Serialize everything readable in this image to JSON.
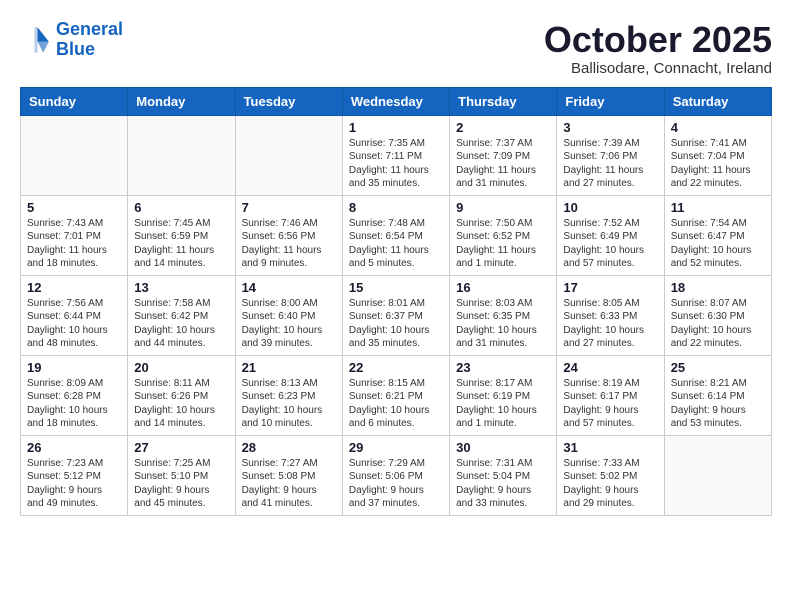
{
  "logo": {
    "line1": "General",
    "line2": "Blue"
  },
  "title": "October 2025",
  "subtitle": "Ballisodare, Connacht, Ireland",
  "days_header": [
    "Sunday",
    "Monday",
    "Tuesday",
    "Wednesday",
    "Thursday",
    "Friday",
    "Saturday"
  ],
  "weeks": [
    [
      {
        "day": "",
        "info": ""
      },
      {
        "day": "",
        "info": ""
      },
      {
        "day": "",
        "info": ""
      },
      {
        "day": "1",
        "info": "Sunrise: 7:35 AM\nSunset: 7:11 PM\nDaylight: 11 hours\nand 35 minutes."
      },
      {
        "day": "2",
        "info": "Sunrise: 7:37 AM\nSunset: 7:09 PM\nDaylight: 11 hours\nand 31 minutes."
      },
      {
        "day": "3",
        "info": "Sunrise: 7:39 AM\nSunset: 7:06 PM\nDaylight: 11 hours\nand 27 minutes."
      },
      {
        "day": "4",
        "info": "Sunrise: 7:41 AM\nSunset: 7:04 PM\nDaylight: 11 hours\nand 22 minutes."
      }
    ],
    [
      {
        "day": "5",
        "info": "Sunrise: 7:43 AM\nSunset: 7:01 PM\nDaylight: 11 hours\nand 18 minutes."
      },
      {
        "day": "6",
        "info": "Sunrise: 7:45 AM\nSunset: 6:59 PM\nDaylight: 11 hours\nand 14 minutes."
      },
      {
        "day": "7",
        "info": "Sunrise: 7:46 AM\nSunset: 6:56 PM\nDaylight: 11 hours\nand 9 minutes."
      },
      {
        "day": "8",
        "info": "Sunrise: 7:48 AM\nSunset: 6:54 PM\nDaylight: 11 hours\nand 5 minutes."
      },
      {
        "day": "9",
        "info": "Sunrise: 7:50 AM\nSunset: 6:52 PM\nDaylight: 11 hours\nand 1 minute."
      },
      {
        "day": "10",
        "info": "Sunrise: 7:52 AM\nSunset: 6:49 PM\nDaylight: 10 hours\nand 57 minutes."
      },
      {
        "day": "11",
        "info": "Sunrise: 7:54 AM\nSunset: 6:47 PM\nDaylight: 10 hours\nand 52 minutes."
      }
    ],
    [
      {
        "day": "12",
        "info": "Sunrise: 7:56 AM\nSunset: 6:44 PM\nDaylight: 10 hours\nand 48 minutes."
      },
      {
        "day": "13",
        "info": "Sunrise: 7:58 AM\nSunset: 6:42 PM\nDaylight: 10 hours\nand 44 minutes."
      },
      {
        "day": "14",
        "info": "Sunrise: 8:00 AM\nSunset: 6:40 PM\nDaylight: 10 hours\nand 39 minutes."
      },
      {
        "day": "15",
        "info": "Sunrise: 8:01 AM\nSunset: 6:37 PM\nDaylight: 10 hours\nand 35 minutes."
      },
      {
        "day": "16",
        "info": "Sunrise: 8:03 AM\nSunset: 6:35 PM\nDaylight: 10 hours\nand 31 minutes."
      },
      {
        "day": "17",
        "info": "Sunrise: 8:05 AM\nSunset: 6:33 PM\nDaylight: 10 hours\nand 27 minutes."
      },
      {
        "day": "18",
        "info": "Sunrise: 8:07 AM\nSunset: 6:30 PM\nDaylight: 10 hours\nand 22 minutes."
      }
    ],
    [
      {
        "day": "19",
        "info": "Sunrise: 8:09 AM\nSunset: 6:28 PM\nDaylight: 10 hours\nand 18 minutes."
      },
      {
        "day": "20",
        "info": "Sunrise: 8:11 AM\nSunset: 6:26 PM\nDaylight: 10 hours\nand 14 minutes."
      },
      {
        "day": "21",
        "info": "Sunrise: 8:13 AM\nSunset: 6:23 PM\nDaylight: 10 hours\nand 10 minutes."
      },
      {
        "day": "22",
        "info": "Sunrise: 8:15 AM\nSunset: 6:21 PM\nDaylight: 10 hours\nand 6 minutes."
      },
      {
        "day": "23",
        "info": "Sunrise: 8:17 AM\nSunset: 6:19 PM\nDaylight: 10 hours\nand 1 minute."
      },
      {
        "day": "24",
        "info": "Sunrise: 8:19 AM\nSunset: 6:17 PM\nDaylight: 9 hours\nand 57 minutes."
      },
      {
        "day": "25",
        "info": "Sunrise: 8:21 AM\nSunset: 6:14 PM\nDaylight: 9 hours\nand 53 minutes."
      }
    ],
    [
      {
        "day": "26",
        "info": "Sunrise: 7:23 AM\nSunset: 5:12 PM\nDaylight: 9 hours\nand 49 minutes."
      },
      {
        "day": "27",
        "info": "Sunrise: 7:25 AM\nSunset: 5:10 PM\nDaylight: 9 hours\nand 45 minutes."
      },
      {
        "day": "28",
        "info": "Sunrise: 7:27 AM\nSunset: 5:08 PM\nDaylight: 9 hours\nand 41 minutes."
      },
      {
        "day": "29",
        "info": "Sunrise: 7:29 AM\nSunset: 5:06 PM\nDaylight: 9 hours\nand 37 minutes."
      },
      {
        "day": "30",
        "info": "Sunrise: 7:31 AM\nSunset: 5:04 PM\nDaylight: 9 hours\nand 33 minutes."
      },
      {
        "day": "31",
        "info": "Sunrise: 7:33 AM\nSunset: 5:02 PM\nDaylight: 9 hours\nand 29 minutes."
      },
      {
        "day": "",
        "info": ""
      }
    ]
  ]
}
